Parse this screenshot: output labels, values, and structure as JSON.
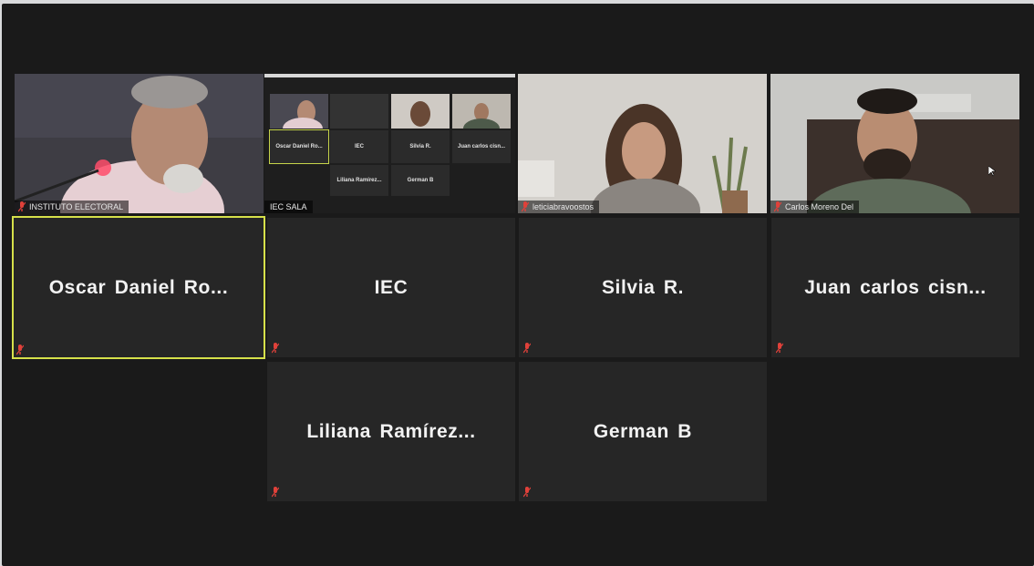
{
  "participants": {
    "video": [
      {
        "label": "INSTITUTO ELECTORAL"
      },
      {
        "label": "IEC SALA"
      },
      {
        "label": "leticiabravoostos"
      },
      {
        "label": "Carlos Moreno Del"
      }
    ],
    "names": [
      {
        "name": "Oscar  Daniel  Ro..."
      },
      {
        "name": "IEC"
      },
      {
        "name": "Silvia  R."
      },
      {
        "name": "Juan  carlos  cisn..."
      },
      {
        "name": "Liliana  Ramírez..."
      },
      {
        "name": "German  B"
      }
    ]
  },
  "mini_gallery": {
    "names": [
      "Oscar Daniel Ro...",
      "IEC",
      "Silvia R.",
      "Juan carlos cisn...",
      "Liliana Ramírez...",
      "German B"
    ]
  },
  "colors": {
    "background": "#1a1a1a",
    "tile": "#262626",
    "active_speaker": "#d6e04a",
    "muted_mic": "#e0413a"
  },
  "icons": {
    "muted": "mic-muted-icon",
    "cursor": "mouse-pointer-icon"
  }
}
